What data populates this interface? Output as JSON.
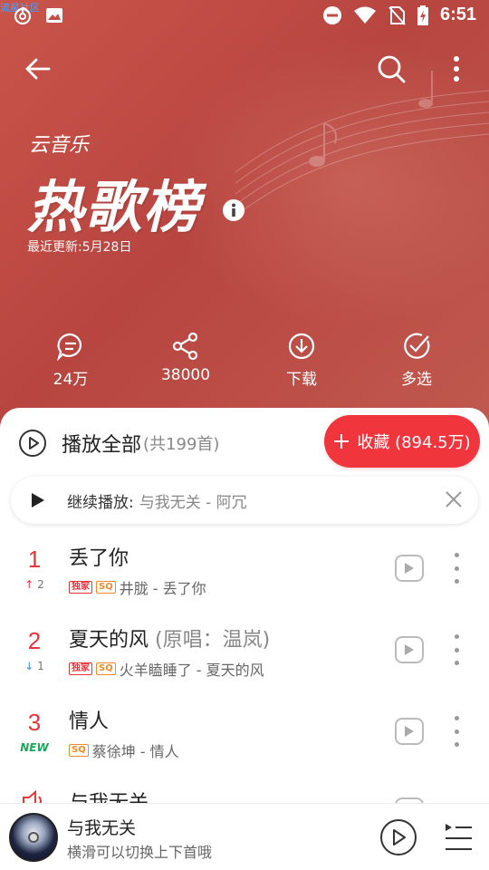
{
  "status_bar": {
    "watermark": "流星社区",
    "time": "6:51",
    "icons": [
      "music-app-icon",
      "image-icon",
      "do-not-disturb-icon",
      "wifi-icon",
      "no-sim-icon",
      "battery-charging-icon"
    ]
  },
  "toolbar": {
    "back_icon": "back-arrow-icon",
    "search_icon": "search-icon",
    "more_icon": "more-vertical-icon"
  },
  "header": {
    "brand_small": "云音乐",
    "brand_big": "热歌榜",
    "updated": "最近更新:5月28日"
  },
  "actions": [
    {
      "icon": "comment-icon",
      "label": "24万"
    },
    {
      "icon": "share-icon",
      "label": "38000"
    },
    {
      "icon": "download-icon",
      "label": "下载"
    },
    {
      "icon": "multi-select-icon",
      "label": "多选"
    }
  ],
  "playlist": {
    "play_all_label": "播放全部",
    "count_label": "(共199首)",
    "collect_label": "收藏 (894.5万)",
    "resume_label": "继续播放:",
    "resume_song": "与我无关 - 阿冗"
  },
  "songs": [
    {
      "rank": "1",
      "trend_symbol": "↑",
      "trend_value": "2",
      "trend": "up",
      "title": "丢了你",
      "alt": "",
      "tags": [
        "独家",
        "SQ"
      ],
      "meta": "井胧 - 丢了你"
    },
    {
      "rank": "2",
      "trend_symbol": "↓",
      "trend_value": "1",
      "trend": "down",
      "title": "夏天的风",
      "alt": "(原唱：温岚)",
      "tags": [
        "独家",
        "SQ"
      ],
      "meta": "火羊瞌睡了 - 夏天的风"
    },
    {
      "rank": "3",
      "trend_symbol": "",
      "trend_value": "NEW",
      "trend": "new",
      "title": "情人",
      "alt": "",
      "tags": [
        "SQ"
      ],
      "meta": "蔡徐坤 - 情人"
    },
    {
      "rank": "",
      "trend_symbol": "",
      "trend_value": "",
      "trend": "playing",
      "title": "与我无关",
      "alt": "",
      "tags": [],
      "meta": ""
    }
  ],
  "player": {
    "title": "与我无关",
    "subtitle": "横滑可以切换上下首哦"
  },
  "colors": {
    "hero": "#c24d45",
    "accent_red": "#f0353c",
    "rank_red": "#e8343b",
    "new_green": "#1aa85a",
    "down_blue": "#3a8ef0"
  }
}
